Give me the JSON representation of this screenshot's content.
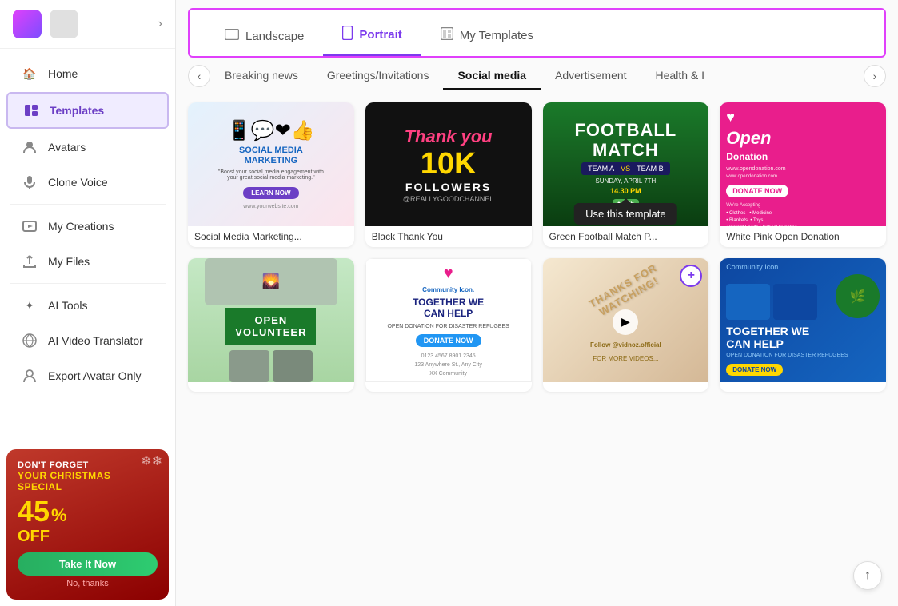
{
  "sidebar": {
    "nav_items": [
      {
        "id": "home",
        "label": "Home",
        "icon": "🏠"
      },
      {
        "id": "templates",
        "label": "Templates",
        "icon": "▶",
        "active": true
      },
      {
        "id": "avatars",
        "label": "Avatars",
        "icon": "👤"
      },
      {
        "id": "clone_voice",
        "label": "Clone Voice",
        "icon": "🎤"
      },
      {
        "id": "my_creations",
        "label": "My Creations",
        "icon": "▶"
      },
      {
        "id": "my_files",
        "label": "My Files",
        "icon": "⬆"
      },
      {
        "id": "ai_tools",
        "label": "AI Tools",
        "icon": "✦"
      },
      {
        "id": "ai_video_translator",
        "label": "AI Video Translator",
        "icon": "🌐"
      },
      {
        "id": "export_avatar_only",
        "label": "Export Avatar Only",
        "icon": "👤"
      }
    ],
    "promo": {
      "dont_forget": "DON'T FORGET",
      "xmas_special": "YOUR CHRISTMAS SPECIAL",
      "discount": "45",
      "percent": "%",
      "off": "OFF",
      "btn_label": "Take It Now",
      "no_thanks": "No, thanks"
    }
  },
  "tabs_top": [
    {
      "id": "landscape",
      "label": "Landscape",
      "icon": "⬜",
      "active": false
    },
    {
      "id": "portrait",
      "label": "Portrait",
      "icon": "📱",
      "active": true
    },
    {
      "id": "my_templates",
      "label": "My Templates",
      "icon": "⬜",
      "active": false
    }
  ],
  "category_tabs": [
    {
      "id": "breaking_news",
      "label": "Breaking news",
      "active": false
    },
    {
      "id": "greetings",
      "label": "Greetings/Invitations",
      "active": false
    },
    {
      "id": "social_media",
      "label": "Social media",
      "active": true
    },
    {
      "id": "advertisement",
      "label": "Advertisement",
      "active": false
    },
    {
      "id": "health",
      "label": "Health &amp; I",
      "active": false
    }
  ],
  "templates": [
    {
      "id": "t1",
      "label": "Social Media Marketing...",
      "row": 1
    },
    {
      "id": "t2",
      "label": "Black Thank You",
      "row": 1
    },
    {
      "id": "t3",
      "label": "Green Football Match P...",
      "row": 1,
      "has_tooltip": true
    },
    {
      "id": "t4",
      "label": "White Pink Open Donation",
      "row": 1
    },
    {
      "id": "t5",
      "label": "",
      "row": 2
    },
    {
      "id": "t6",
      "label": "",
      "row": 2
    },
    {
      "id": "t7",
      "label": "",
      "row": 2,
      "has_plus": true
    },
    {
      "id": "t8",
      "label": "",
      "row": 2
    }
  ],
  "tooltip": "Use this template",
  "icons": {
    "chevron_left": "‹",
    "chevron_right": "›",
    "chevron_down": "›",
    "scroll_top": "↑",
    "play": "▶",
    "plus": "+"
  }
}
